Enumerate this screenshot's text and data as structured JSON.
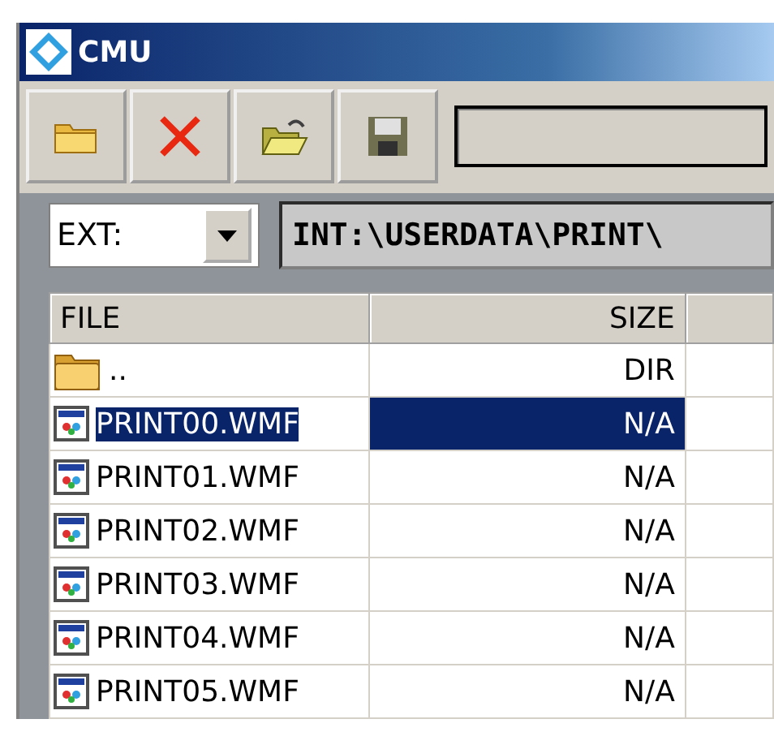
{
  "window": {
    "title": "CMU"
  },
  "toolbar": {
    "buttons": [
      {
        "kind": "folder"
      },
      {
        "kind": "delete"
      },
      {
        "kind": "open"
      },
      {
        "kind": "save"
      }
    ]
  },
  "filter": {
    "value": "EXT:"
  },
  "path": "INT:\\USERDATA\\PRINT\\",
  "table": {
    "columns": [
      "FILE",
      "SIZE"
    ],
    "rows": [
      {
        "kind": "folder",
        "name": "..",
        "size": "DIR",
        "selected": false
      },
      {
        "kind": "file",
        "name": "PRINT00.WMF",
        "size": "N/A",
        "selected": true
      },
      {
        "kind": "file",
        "name": "PRINT01.WMF",
        "size": "N/A",
        "selected": false
      },
      {
        "kind": "file",
        "name": "PRINT02.WMF",
        "size": "N/A",
        "selected": false
      },
      {
        "kind": "file",
        "name": "PRINT03.WMF",
        "size": "N/A",
        "selected": false
      },
      {
        "kind": "file",
        "name": "PRINT04.WMF",
        "size": "N/A",
        "selected": false
      },
      {
        "kind": "file",
        "name": "PRINT05.WMF",
        "size": "N/A",
        "selected": false
      }
    ]
  }
}
